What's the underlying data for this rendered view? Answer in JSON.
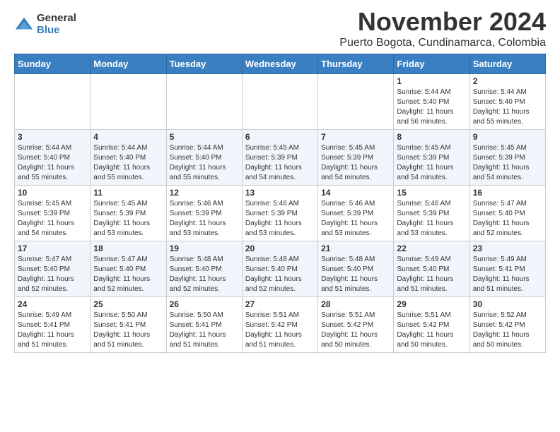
{
  "header": {
    "logo_general": "General",
    "logo_blue": "Blue",
    "month_title": "November 2024",
    "location": "Puerto Bogota, Cundinamarca, Colombia"
  },
  "weekdays": [
    "Sunday",
    "Monday",
    "Tuesday",
    "Wednesday",
    "Thursday",
    "Friday",
    "Saturday"
  ],
  "weeks": [
    [
      {
        "day": "",
        "info": ""
      },
      {
        "day": "",
        "info": ""
      },
      {
        "day": "",
        "info": ""
      },
      {
        "day": "",
        "info": ""
      },
      {
        "day": "",
        "info": ""
      },
      {
        "day": "1",
        "info": "Sunrise: 5:44 AM\nSunset: 5:40 PM\nDaylight: 11 hours\nand 56 minutes."
      },
      {
        "day": "2",
        "info": "Sunrise: 5:44 AM\nSunset: 5:40 PM\nDaylight: 11 hours\nand 55 minutes."
      }
    ],
    [
      {
        "day": "3",
        "info": "Sunrise: 5:44 AM\nSunset: 5:40 PM\nDaylight: 11 hours\nand 55 minutes."
      },
      {
        "day": "4",
        "info": "Sunrise: 5:44 AM\nSunset: 5:40 PM\nDaylight: 11 hours\nand 55 minutes."
      },
      {
        "day": "5",
        "info": "Sunrise: 5:44 AM\nSunset: 5:40 PM\nDaylight: 11 hours\nand 55 minutes."
      },
      {
        "day": "6",
        "info": "Sunrise: 5:45 AM\nSunset: 5:39 PM\nDaylight: 11 hours\nand 54 minutes."
      },
      {
        "day": "7",
        "info": "Sunrise: 5:45 AM\nSunset: 5:39 PM\nDaylight: 11 hours\nand 54 minutes."
      },
      {
        "day": "8",
        "info": "Sunrise: 5:45 AM\nSunset: 5:39 PM\nDaylight: 11 hours\nand 54 minutes."
      },
      {
        "day": "9",
        "info": "Sunrise: 5:45 AM\nSunset: 5:39 PM\nDaylight: 11 hours\nand 54 minutes."
      }
    ],
    [
      {
        "day": "10",
        "info": "Sunrise: 5:45 AM\nSunset: 5:39 PM\nDaylight: 11 hours\nand 54 minutes."
      },
      {
        "day": "11",
        "info": "Sunrise: 5:45 AM\nSunset: 5:39 PM\nDaylight: 11 hours\nand 53 minutes."
      },
      {
        "day": "12",
        "info": "Sunrise: 5:46 AM\nSunset: 5:39 PM\nDaylight: 11 hours\nand 53 minutes."
      },
      {
        "day": "13",
        "info": "Sunrise: 5:46 AM\nSunset: 5:39 PM\nDaylight: 11 hours\nand 53 minutes."
      },
      {
        "day": "14",
        "info": "Sunrise: 5:46 AM\nSunset: 5:39 PM\nDaylight: 11 hours\nand 53 minutes."
      },
      {
        "day": "15",
        "info": "Sunrise: 5:46 AM\nSunset: 5:39 PM\nDaylight: 11 hours\nand 53 minutes."
      },
      {
        "day": "16",
        "info": "Sunrise: 5:47 AM\nSunset: 5:40 PM\nDaylight: 11 hours\nand 52 minutes."
      }
    ],
    [
      {
        "day": "17",
        "info": "Sunrise: 5:47 AM\nSunset: 5:40 PM\nDaylight: 11 hours\nand 52 minutes."
      },
      {
        "day": "18",
        "info": "Sunrise: 5:47 AM\nSunset: 5:40 PM\nDaylight: 11 hours\nand 52 minutes."
      },
      {
        "day": "19",
        "info": "Sunrise: 5:48 AM\nSunset: 5:40 PM\nDaylight: 11 hours\nand 52 minutes."
      },
      {
        "day": "20",
        "info": "Sunrise: 5:48 AM\nSunset: 5:40 PM\nDaylight: 11 hours\nand 52 minutes."
      },
      {
        "day": "21",
        "info": "Sunrise: 5:48 AM\nSunset: 5:40 PM\nDaylight: 11 hours\nand 51 minutes."
      },
      {
        "day": "22",
        "info": "Sunrise: 5:49 AM\nSunset: 5:40 PM\nDaylight: 11 hours\nand 51 minutes."
      },
      {
        "day": "23",
        "info": "Sunrise: 5:49 AM\nSunset: 5:41 PM\nDaylight: 11 hours\nand 51 minutes."
      }
    ],
    [
      {
        "day": "24",
        "info": "Sunrise: 5:49 AM\nSunset: 5:41 PM\nDaylight: 11 hours\nand 51 minutes."
      },
      {
        "day": "25",
        "info": "Sunrise: 5:50 AM\nSunset: 5:41 PM\nDaylight: 11 hours\nand 51 minutes."
      },
      {
        "day": "26",
        "info": "Sunrise: 5:50 AM\nSunset: 5:41 PM\nDaylight: 11 hours\nand 51 minutes."
      },
      {
        "day": "27",
        "info": "Sunrise: 5:51 AM\nSunset: 5:42 PM\nDaylight: 11 hours\nand 51 minutes."
      },
      {
        "day": "28",
        "info": "Sunrise: 5:51 AM\nSunset: 5:42 PM\nDaylight: 11 hours\nand 50 minutes."
      },
      {
        "day": "29",
        "info": "Sunrise: 5:51 AM\nSunset: 5:42 PM\nDaylight: 11 hours\nand 50 minutes."
      },
      {
        "day": "30",
        "info": "Sunrise: 5:52 AM\nSunset: 5:42 PM\nDaylight: 11 hours\nand 50 minutes."
      }
    ]
  ]
}
